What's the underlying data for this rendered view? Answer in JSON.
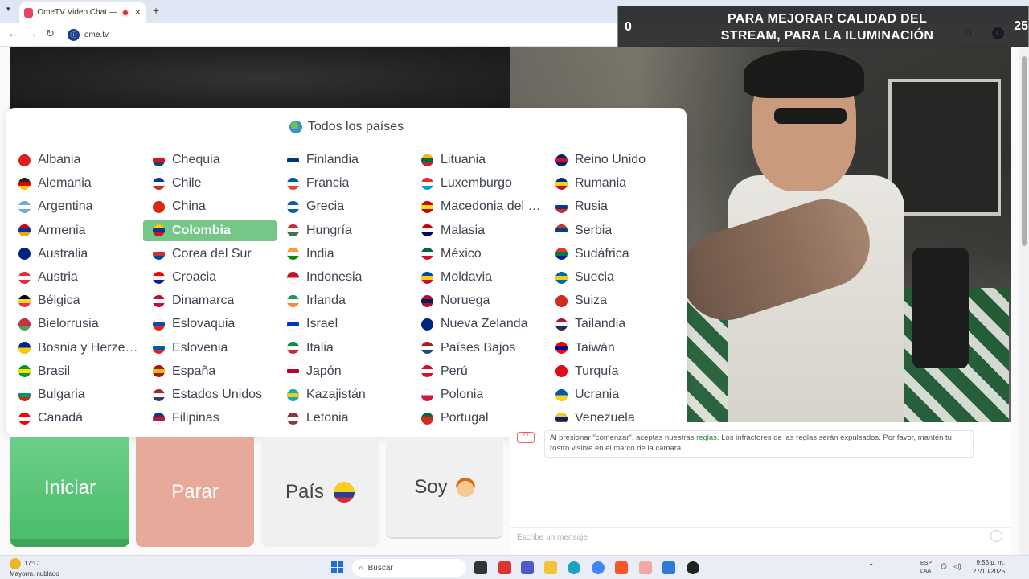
{
  "browser": {
    "tab_title": "OmeTV Video Chat — Onlin",
    "new_tab_symbol": "+",
    "close_symbol": "✕",
    "url": "ome.tv"
  },
  "overlay": {
    "left_number": "0",
    "message": "PARA MEJORAR CALIDAD DEL STREAM, PARA LA ILUMINACIÓN",
    "right_number": "25"
  },
  "country_panel": {
    "header": "Todos los países",
    "selected": "Colombia",
    "countries": [
      {
        "name": "Albania",
        "colors": [
          "#e41e20",
          "#e41e20"
        ]
      },
      {
        "name": "Alemania",
        "colors": [
          "#222",
          "#dd0000",
          "#ffce00"
        ]
      },
      {
        "name": "Argentina",
        "colors": [
          "#74acdf",
          "#ffffff",
          "#74acdf"
        ]
      },
      {
        "name": "Armenia",
        "colors": [
          "#d90012",
          "#0033a0",
          "#f2a800"
        ]
      },
      {
        "name": "Australia",
        "colors": [
          "#00247d",
          "#00247d"
        ]
      },
      {
        "name": "Austria",
        "colors": [
          "#ed2939",
          "#ffffff",
          "#ed2939"
        ]
      },
      {
        "name": "Bélgica",
        "colors": [
          "#000",
          "#fdda24",
          "#ef3340"
        ]
      },
      {
        "name": "Bielorrusia",
        "colors": [
          "#c8313e",
          "#c8313e",
          "#4aa657"
        ]
      },
      {
        "name": "Bosnia y Herze…",
        "colors": [
          "#002395",
          "#fecb00"
        ]
      },
      {
        "name": "Brasil",
        "colors": [
          "#009c3b",
          "#ffdf00",
          "#009c3b"
        ]
      },
      {
        "name": "Bulgaria",
        "colors": [
          "#ffffff",
          "#00966e",
          "#d62612"
        ]
      },
      {
        "name": "Canadá",
        "colors": [
          "#ff0000",
          "#ffffff",
          "#ff0000"
        ]
      },
      {
        "name": "Chequia",
        "colors": [
          "#ffffff",
          "#d7141a",
          "#11457e"
        ]
      },
      {
        "name": "Chile",
        "colors": [
          "#0039a6",
          "#ffffff",
          "#d52b1e"
        ]
      },
      {
        "name": "China",
        "colors": [
          "#de2910",
          "#de2910"
        ]
      },
      {
        "name": "Colombia",
        "colors": [
          "#fcd116",
          "#003893",
          "#ce1126"
        ]
      },
      {
        "name": "Corea del Sur",
        "colors": [
          "#ffffff",
          "#cd2e3a",
          "#0047a0"
        ]
      },
      {
        "name": "Croacia",
        "colors": [
          "#ff0000",
          "#ffffff",
          "#171796"
        ]
      },
      {
        "name": "Dinamarca",
        "colors": [
          "#c60c30",
          "#ffffff",
          "#c60c30"
        ]
      },
      {
        "name": "Eslovaquia",
        "colors": [
          "#ffffff",
          "#0b4ea2",
          "#ee1c25"
        ]
      },
      {
        "name": "Eslovenia",
        "colors": [
          "#ffffff",
          "#005da4",
          "#ed1c24"
        ]
      },
      {
        "name": "España",
        "colors": [
          "#aa151b",
          "#f1bf00",
          "#aa151b"
        ]
      },
      {
        "name": "Estados Unidos",
        "colors": [
          "#b22234",
          "#ffffff",
          "#3c3b6e"
        ]
      },
      {
        "name": "Filipinas",
        "colors": [
          "#0038a8",
          "#ce1126",
          "#ffffff"
        ]
      },
      {
        "name": "Finlandia",
        "colors": [
          "#ffffff",
          "#003580",
          "#ffffff"
        ]
      },
      {
        "name": "Francia",
        "colors": [
          "#0055a4",
          "#ffffff",
          "#ef4135"
        ]
      },
      {
        "name": "Grecia",
        "colors": [
          "#0d5eaf",
          "#ffffff",
          "#0d5eaf"
        ]
      },
      {
        "name": "Hungría",
        "colors": [
          "#ce2939",
          "#ffffff",
          "#477050"
        ]
      },
      {
        "name": "India",
        "colors": [
          "#ff9933",
          "#ffffff",
          "#138808"
        ]
      },
      {
        "name": "Indonesia",
        "colors": [
          "#ce1126",
          "#ffffff"
        ]
      },
      {
        "name": "Irlanda",
        "colors": [
          "#169b62",
          "#ffffff",
          "#ff883e"
        ]
      },
      {
        "name": "Israel",
        "colors": [
          "#ffffff",
          "#0038b8",
          "#ffffff"
        ]
      },
      {
        "name": "Italia",
        "colors": [
          "#009246",
          "#ffffff",
          "#ce2b37"
        ]
      },
      {
        "name": "Japón",
        "colors": [
          "#ffffff",
          "#bc002d",
          "#ffffff"
        ]
      },
      {
        "name": "Kazajistán",
        "colors": [
          "#00afca",
          "#fec50c",
          "#00afca"
        ]
      },
      {
        "name": "Letonia",
        "colors": [
          "#9e3039",
          "#ffffff",
          "#9e3039"
        ]
      },
      {
        "name": "Lituania",
        "colors": [
          "#fdb913",
          "#006a44",
          "#c1272d"
        ]
      },
      {
        "name": "Luxemburgo",
        "colors": [
          "#ed2939",
          "#ffffff",
          "#00a1de"
        ]
      },
      {
        "name": "Macedonia del …",
        "colors": [
          "#d20000",
          "#ffe600",
          "#d20000"
        ]
      },
      {
        "name": "Malasia",
        "colors": [
          "#cc0001",
          "#ffffff",
          "#010066"
        ]
      },
      {
        "name": "México",
        "colors": [
          "#006847",
          "#ffffff",
          "#ce1126"
        ]
      },
      {
        "name": "Moldavia",
        "colors": [
          "#0046ae",
          "#ffd200",
          "#cc092f"
        ]
      },
      {
        "name": "Noruega",
        "colors": [
          "#ba0c2f",
          "#00205b",
          "#ba0c2f"
        ]
      },
      {
        "name": "Nueva Zelanda",
        "colors": [
          "#00247d",
          "#00247d"
        ]
      },
      {
        "name": "Países Bajos",
        "colors": [
          "#ae1c28",
          "#ffffff",
          "#21468b"
        ]
      },
      {
        "name": "Perú",
        "colors": [
          "#d91023",
          "#ffffff",
          "#d91023"
        ]
      },
      {
        "name": "Polonia",
        "colors": [
          "#ffffff",
          "#dc143c"
        ]
      },
      {
        "name": "Portugal",
        "colors": [
          "#046a38",
          "#da291c",
          "#da291c"
        ]
      },
      {
        "name": "Reino Unido",
        "colors": [
          "#012169",
          "#c8102e",
          "#012169"
        ]
      },
      {
        "name": "Rumania",
        "colors": [
          "#002b7f",
          "#fcd116",
          "#ce1126"
        ]
      },
      {
        "name": "Rusia",
        "colors": [
          "#ffffff",
          "#0039a6",
          "#d52b1e"
        ]
      },
      {
        "name": "Serbia",
        "colors": [
          "#c6363c",
          "#0c4076",
          "#ffffff"
        ]
      },
      {
        "name": "Sudáfrica",
        "colors": [
          "#de3831",
          "#007a4d",
          "#002395"
        ]
      },
      {
        "name": "Suecia",
        "colors": [
          "#006aa7",
          "#fecc00",
          "#006aa7"
        ]
      },
      {
        "name": "Suiza",
        "colors": [
          "#d52b1e",
          "#d52b1e"
        ]
      },
      {
        "name": "Tailandia",
        "colors": [
          "#a51931",
          "#f4f5f8",
          "#2d2a4a"
        ]
      },
      {
        "name": "Taiwán",
        "colors": [
          "#fe0000",
          "#000095",
          "#fe0000"
        ]
      },
      {
        "name": "Turquía",
        "colors": [
          "#e30a17",
          "#e30a17"
        ]
      },
      {
        "name": "Ucrania",
        "colors": [
          "#0057b7",
          "#ffd700"
        ]
      },
      {
        "name": "Venezuela",
        "colors": [
          "#ffcc00",
          "#00247d",
          "#cf142b"
        ]
      }
    ]
  },
  "controls": {
    "start_label": "Iniciar",
    "stop_label": "Parar",
    "country_label": "País",
    "iam_label": "Soy"
  },
  "chat": {
    "avatar_text": "TV",
    "notice_prefix": "Al presionar \"comenzar\", aceptas nuestras ",
    "notice_link": "reglas",
    "notice_suffix": ". Los infractores de las reglas serán expulsados. Por favor, mantén tu rostro visible en el marco de la cámara.",
    "input_placeholder": "Escribe un mensaje"
  },
  "taskbar": {
    "temperature": "17°C",
    "weather_desc": "Mayorm. nublado",
    "search_placeholder": "Buscar",
    "lang_top": "ESP",
    "lang_bottom": "LAA",
    "time": "9:55 p. m.",
    "date": "27/10/2025"
  },
  "colors": {
    "accent_green": "#75c787",
    "start_green": "#4bbd6b",
    "stop_salmon": "#e7a99a"
  }
}
